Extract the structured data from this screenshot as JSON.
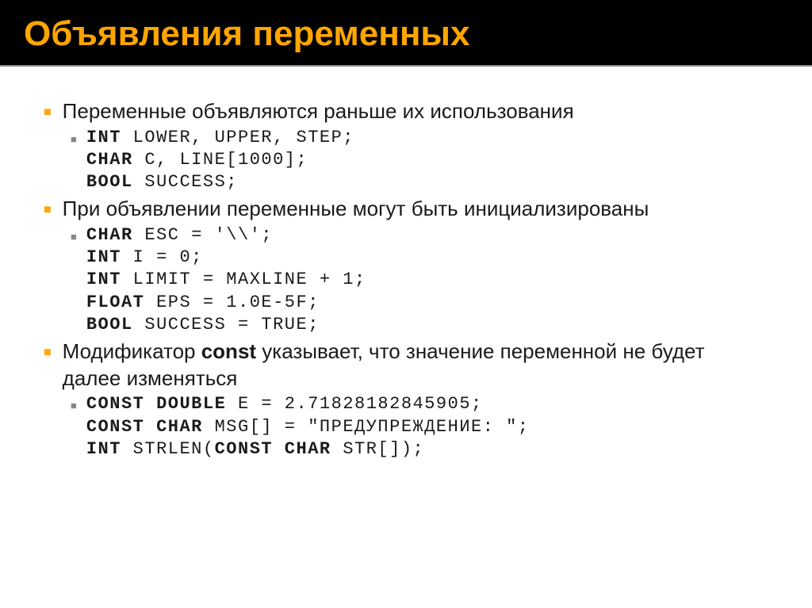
{
  "title": "Объявления переменных",
  "items": [
    {
      "text": "Переменные объявляются раньше их использования",
      "code": {
        "kw1": "int",
        "rest1": " lower, upper, step;",
        "kw2": "char",
        "rest2": " c, line[1000];",
        "kw3": "bool",
        "rest3": " success;"
      }
    },
    {
      "text": "При объявлении переменные могут быть инициализированы",
      "code": {
        "kw1": "char",
        "rest1": " esc = '\\\\';",
        "kw2": "int",
        "rest2": " i = 0;",
        "kw3": "int",
        "rest3": " limit = MAXLINE + 1;",
        "kw4": "float",
        "rest4": " eps = 1.0e-5f;",
        "kw5": "bool",
        "rest5": " success = true;"
      }
    },
    {
      "pre": "Модификатор ",
      "bold": "const",
      "post": " указывает, что значение переменной не будет далее изменяться",
      "code": {
        "kw1": "const double",
        "rest1": " e = 2.71828182845905;",
        "kw2": "const char",
        "rest2": " msg[] = \"предупреждение: \";",
        "kw3": "int",
        "rest3": " strlen(",
        "kw3b": "const char",
        "rest3b": " str[]);"
      }
    }
  ]
}
